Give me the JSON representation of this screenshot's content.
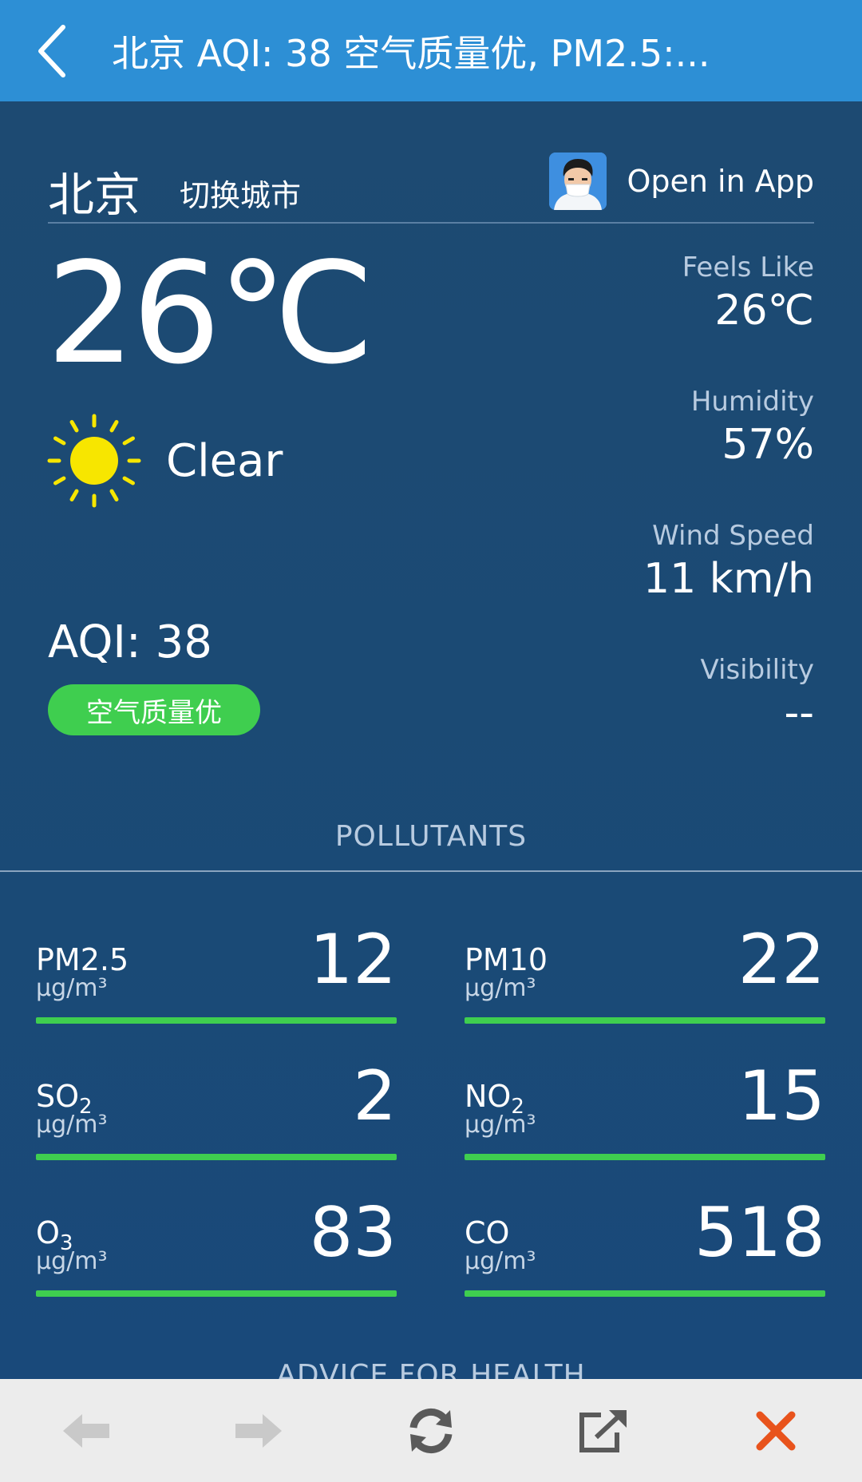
{
  "topbar": {
    "back_icon": "chevron-left-icon",
    "title": "北京 AQI: 38 空气质量优, PM2.5:..."
  },
  "header": {
    "city": "北京",
    "switch_city": "切换城市",
    "open_app": "Open in App",
    "app_icon": "masked-person-avatar-icon"
  },
  "weather": {
    "temperature": "26℃",
    "condition": "Clear",
    "condition_icon": "sun-icon",
    "feels_like_label": "Feels Like",
    "feels_like_value": "26℃",
    "humidity_label": "Humidity",
    "humidity_value": "57%",
    "wind_label": "Wind Speed",
    "wind_value": "11 km/h",
    "visibility_label": "Visibility",
    "visibility_value": "--"
  },
  "aqi": {
    "label": "AQI: 38",
    "badge": "空气质量优",
    "badge_color": "#3fce4f"
  },
  "pollutants": {
    "title": "POLLUTANTS",
    "items": [
      {
        "name": "PM2.5",
        "unit": "μg/m³",
        "value": "12"
      },
      {
        "name": "PM10",
        "unit": "μg/m³",
        "value": "22"
      },
      {
        "name_main": "SO",
        "name_sub": "2",
        "unit": "μg/m³",
        "value": "2"
      },
      {
        "name_main": "NO",
        "name_sub": "2",
        "unit": "μg/m³",
        "value": "15"
      },
      {
        "name_main": "O",
        "name_sub": "3",
        "unit": "μg/m³",
        "value": "83"
      },
      {
        "name": "CO",
        "unit": "μg/m³",
        "value": "518"
      }
    ]
  },
  "advice": {
    "title": "ADVICE FOR HEALTH"
  },
  "toolbar": {
    "back_icon": "arrow-left-icon",
    "forward_icon": "arrow-right-icon",
    "refresh_icon": "refresh-icon",
    "share_icon": "open-external-icon",
    "close_icon": "close-icon",
    "close_color": "#e8531c"
  },
  "colors": {
    "topbar": "#2d8fd5",
    "background": "#1b4a74",
    "good_green": "#3fce4f"
  }
}
